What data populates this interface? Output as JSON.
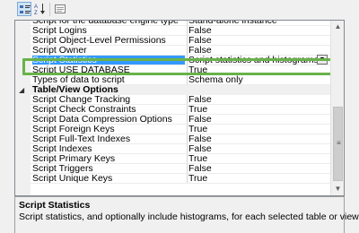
{
  "toolbar": {
    "categorized_tooltip": "Categorized",
    "alphabetical_tooltip": "Alphabetical",
    "pages_tooltip": "Property Pages"
  },
  "grid": {
    "rows": [
      {
        "name": "Script for the database engine type",
        "value": "Stand-alone instance"
      },
      {
        "name": "Script Logins",
        "value": "False"
      },
      {
        "name": "Script Object-Level Permissions",
        "value": "False"
      },
      {
        "name": "Script Owner",
        "value": "False"
      },
      {
        "name": "Script Statistics",
        "value": "Script statistics and histograms",
        "selected": true
      },
      {
        "name": "Script USE DATABASE",
        "value": "True"
      },
      {
        "name": "Types of data to script",
        "value": "Schema only"
      },
      {
        "category": "Table/View Options"
      },
      {
        "name": "Script Change Tracking",
        "value": "False"
      },
      {
        "name": "Script Check Constraints",
        "value": "True"
      },
      {
        "name": "Script Data Compression Options",
        "value": "False"
      },
      {
        "name": "Script Foreign Keys",
        "value": "True"
      },
      {
        "name": "Script Full-Text Indexes",
        "value": "False"
      },
      {
        "name": "Script Indexes",
        "value": "False"
      },
      {
        "name": "Script Primary Keys",
        "value": "True"
      },
      {
        "name": "Script Triggers",
        "value": "False"
      },
      {
        "name": "Script Unique Keys",
        "value": "True"
      }
    ],
    "category_toggle": "◢"
  },
  "description": {
    "title": "Script Statistics",
    "text": "Script statistics, and optionally include histograms, for each selected table or view."
  },
  "colors": {
    "selection": "#3399ff",
    "callout": "#69b24a"
  }
}
